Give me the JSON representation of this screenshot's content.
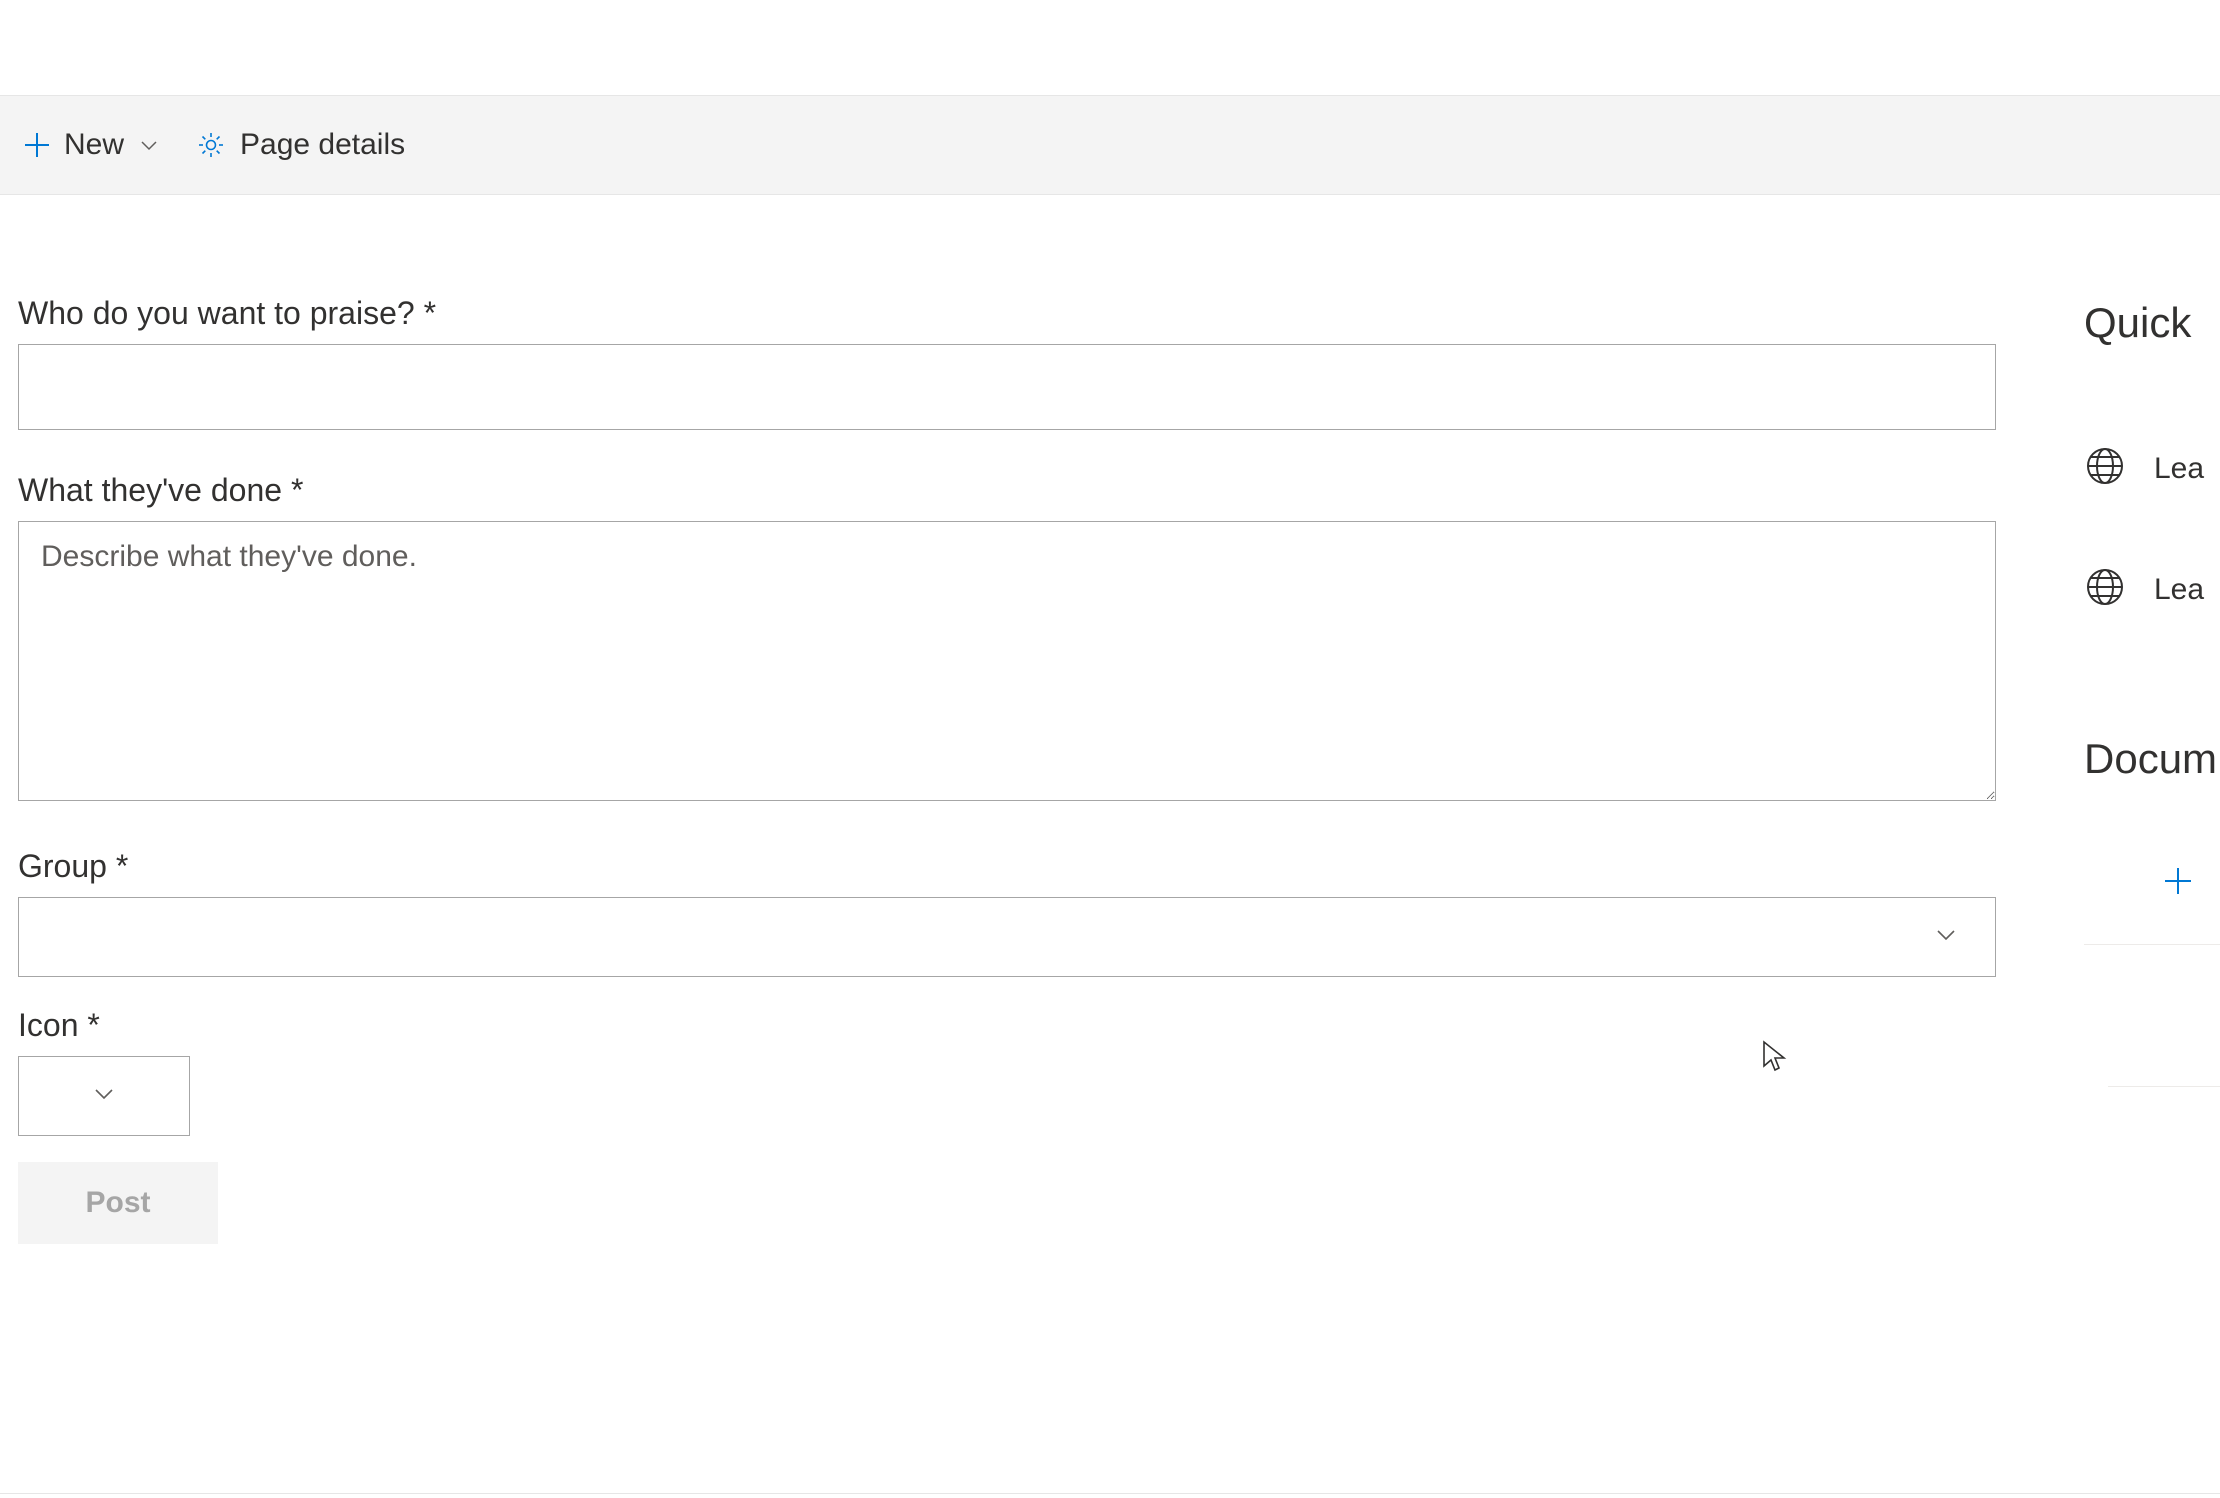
{
  "commandBar": {
    "newLabel": "New",
    "pageDetailsLabel": "Page details"
  },
  "form": {
    "praiseLabel": "Who do you want to praise? *",
    "praiseValue": "",
    "doneLabel": "What they've done *",
    "donePlaceholder": "Describe what they've done.",
    "doneValue": "",
    "groupLabel": "Group *",
    "groupValue": "",
    "iconLabel": "Icon *",
    "iconValue": "",
    "postLabel": "Post"
  },
  "sidebar": {
    "quickHeading": "Quick",
    "links": [
      {
        "label": "Lea"
      },
      {
        "label": "Lea"
      }
    ],
    "docsHeading": "Docum"
  }
}
